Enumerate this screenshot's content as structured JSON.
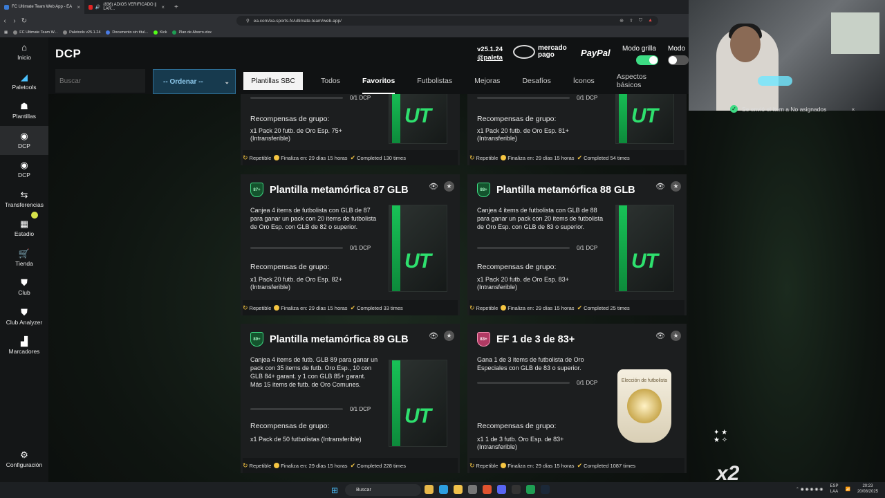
{
  "browser": {
    "tabs": [
      {
        "label": "FC Ultimate Team Web App - EA",
        "active": true
      },
      {
        "label": "(836) ADIOS VERIFICADO || LAR...",
        "active": false
      }
    ],
    "url": "ea.com/ea-sports-fc/ultimate-team/web-app/",
    "bookmarks": [
      "FC Ultimate Team W...",
      "Paletools v25.1.24",
      "Documento sin títul...",
      "Kick",
      "Plan de Ahorro.xlsx"
    ]
  },
  "sidebar": {
    "items": [
      {
        "label": "Inicio",
        "icon": "home-icon",
        "glyph": "⌂",
        "active": false
      },
      {
        "label": "Paletools",
        "icon": "paletools-icon",
        "glyph": "◢",
        "active": false
      },
      {
        "label": "Plantillas",
        "icon": "squad-icon",
        "glyph": "☗",
        "active": false
      },
      {
        "label": "DCP",
        "icon": "dcp-icon",
        "glyph": "◉",
        "active": true
      },
      {
        "label": "DCP",
        "icon": "dcp-icon",
        "glyph": "◉",
        "active": false
      },
      {
        "label": "Transferencias",
        "icon": "transfer-icon",
        "glyph": "⇆",
        "active": false
      },
      {
        "label": "Estadio",
        "icon": "stadium-icon",
        "glyph": "▦",
        "active": false
      },
      {
        "label": "Tienda",
        "icon": "cart-icon",
        "glyph": "🛒",
        "active": false
      },
      {
        "label": "Club",
        "icon": "club-icon",
        "glyph": "⛊",
        "active": false
      },
      {
        "label": "Club Analyzer",
        "icon": "analyzer-icon",
        "glyph": "⛊",
        "active": false
      },
      {
        "label": "Marcadores",
        "icon": "leaderboard-icon",
        "glyph": "▟",
        "active": false
      }
    ],
    "settings": {
      "label": "Configuración",
      "icon": "gear-icon",
      "glyph": "⚙"
    }
  },
  "header": {
    "title": "DCP",
    "version": "v25.1.24",
    "handle": "@paleta",
    "mercadopago_line1": "mercado",
    "mercadopago_line2": "pago",
    "paypal": "PayPal",
    "grid_mode_label": "Modo grilla",
    "mode2_label": "Modo"
  },
  "filters": {
    "search_placeholder": "Buscar",
    "order_label": "-- Ordenar --",
    "sbc_button": "Plantillas SBC",
    "tabs": [
      "Todos",
      "Favoritos",
      "Futbolistas",
      "Mejoras",
      "Desafíos",
      "Íconos",
      "Aspectos básicos"
    ],
    "active_tab": "Favoritos"
  },
  "cards": [
    {
      "title": "",
      "progress": "0/1 DCP",
      "reward_title": "Recompensas de grupo:",
      "reward": "x1 Pack 20 futb. de Oro Esp. 75+ (Intransferible)",
      "repeatable": "Repetible",
      "ends": "Finaliza en: 29 días 15 horas",
      "completed": "Completed 130 times"
    },
    {
      "title": "",
      "progress": "0/1 DCP",
      "reward_title": "Recompensas de grupo:",
      "reward": "x1 Pack 20 futb. de Oro Esp. 81+ (Intransferible)",
      "repeatable": "Repetible",
      "ends": "Finaliza en: 29 días 15 horas",
      "completed": "Completed 54 times"
    },
    {
      "badge": "87+",
      "title": "Plantilla metamórfica 87 GLB",
      "desc": "Canjea 4 items de futbolista con GLB de 87 para ganar un pack con 20 items de futbolista de Oro Esp. con GLB de 82 o superior.",
      "progress": "0/1 DCP",
      "reward_title": "Recompensas de grupo:",
      "reward": "x1 Pack 20 futb. de Oro Esp. 82+ (Intransferible)",
      "repeatable": "Repetible",
      "ends": "Finaliza en: 29 días 15 horas",
      "completed": "Completed 33 times"
    },
    {
      "badge": "88+",
      "title": "Plantilla metamórfica 88 GLB",
      "desc": "Canjea 4 items de futbolista con GLB de 88 para ganar un pack con 20 items de futbolista de Oro Esp. con GLB de 83 o superior.",
      "progress": "0/1 DCP",
      "reward_title": "Recompensas de grupo:",
      "reward": "x1 Pack 20 futb. de Oro Esp. 83+ (Intransferible)",
      "repeatable": "Repetible",
      "ends": "Finaliza en: 29 días 15 horas",
      "completed": "Completed 25 times"
    },
    {
      "badge": "89+",
      "title": "Plantilla metamórfica 89 GLB",
      "desc": "Canjea 4 items de futb. GLB 89 para ganar un pack con 35 items de futb. Oro Esp., 10 con GLB 84+ garant. y 1 con GLB 85+ garant. Más 15 items de futb. de Oro Comunes.",
      "progress": "0/1 DCP",
      "reward_title": "Recompensas de grupo:",
      "reward": "x1 Pack de 50 futbolistas (Intransferible)",
      "repeatable": "Repetible",
      "ends": "Finaliza en: 29 días 15 horas",
      "completed": "Completed 228 times"
    },
    {
      "badge": "83+",
      "title": "EF 1 de 3 de 83+",
      "desc": "Gana 1 de 3 items de futbolista de Oro Especiales con GLB de 83 o superior.",
      "progress": "0/1 DCP",
      "reward_title": "Recompensas de grupo:",
      "reward": "x1 1 de 3 futb. Oro Esp. de 83+ (Intransferible)",
      "pack_label": "Elección de futbolista",
      "repeatable": "Repetible",
      "ends": "Finaliza en: 29 días 15 horas",
      "completed": "Completed 1087 times"
    }
  ],
  "overlay": {
    "notification": "Se envió el ítem a No asignados",
    "multiplier": "x2"
  },
  "taskbar": {
    "search": "Buscar",
    "lang_line1": "ESP",
    "lang_line2": "LAA",
    "time": "20:23",
    "date": "20/08/2025"
  }
}
